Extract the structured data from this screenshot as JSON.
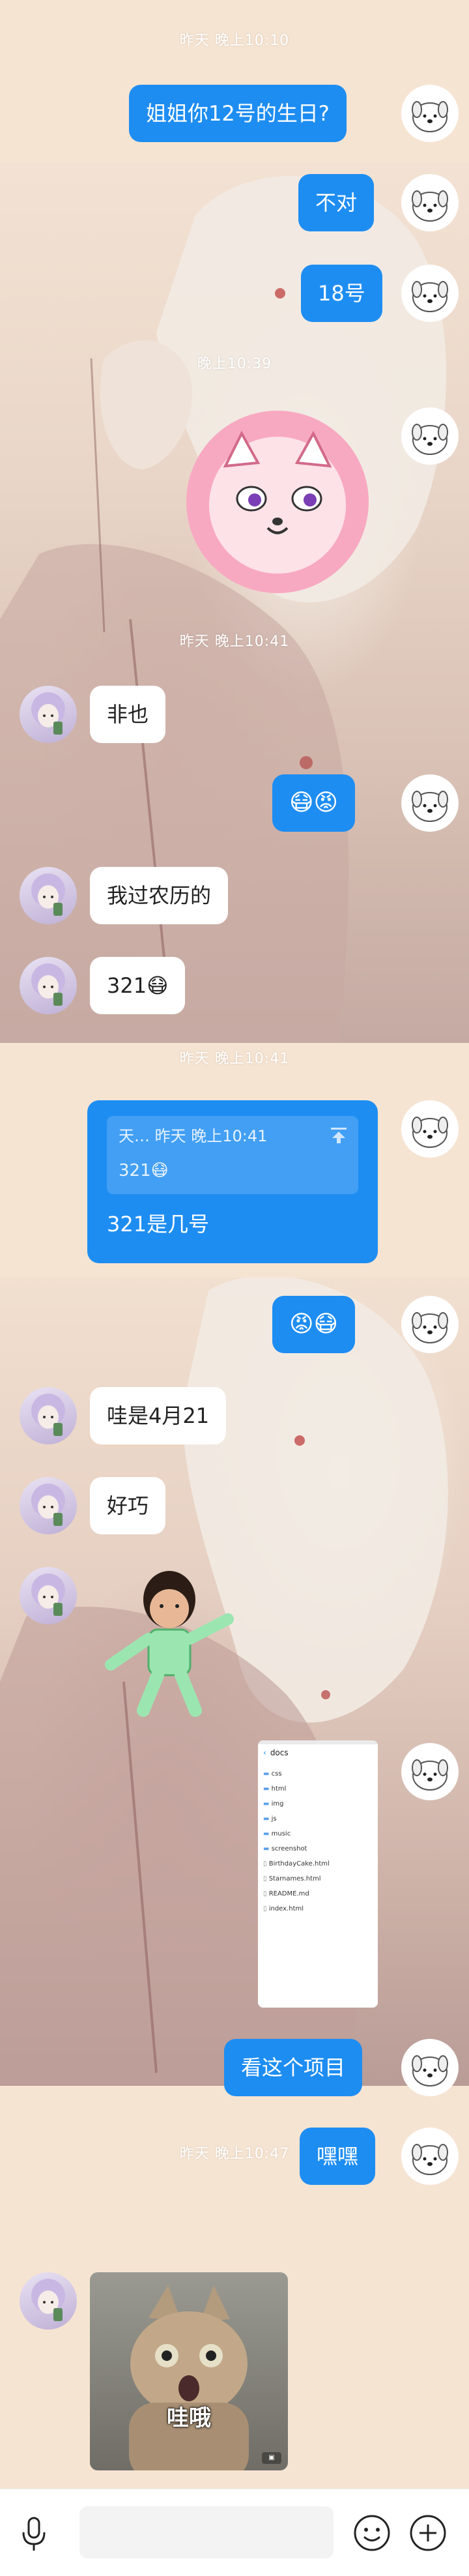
{
  "timestamps": {
    "t1": "昨天 晚上10:10",
    "t2": "晚上10:39",
    "t3": "昨天 晚上10:41",
    "t4": "昨天 晚上10:41",
    "t5": "昨天 晚上10:47"
  },
  "messages": {
    "m1": "姐姐你12号的生日?",
    "m2": "不对",
    "m3": "18号",
    "m4": "非也",
    "m5": "😷😡",
    "m6": "我过农历的",
    "m7": "321😷",
    "m8_quote_header": "天…   昨天 晚上10:41",
    "m8_quote_body": "321😷",
    "m8_text": "321是几号",
    "m9": "😡😷",
    "m10": "哇是4月21",
    "m11": "好巧",
    "m12": "看这个项目",
    "m13": "嘿嘿",
    "m14_caption": "哇哦"
  },
  "file_screenshot": {
    "title": "docs",
    "items": [
      "css",
      "html",
      "img",
      "js",
      "music",
      "screenshot",
      "BirthdayCake.html",
      "Starnames.html",
      "README.md",
      "index.html"
    ]
  },
  "colors": {
    "my_bubble": "#1e8df2",
    "her_bubble": "#ffffff",
    "background": "#f6e4d2"
  },
  "icons": {
    "voice": "microphone-icon",
    "emoji": "smiley-icon",
    "more": "plus-circle-icon"
  }
}
